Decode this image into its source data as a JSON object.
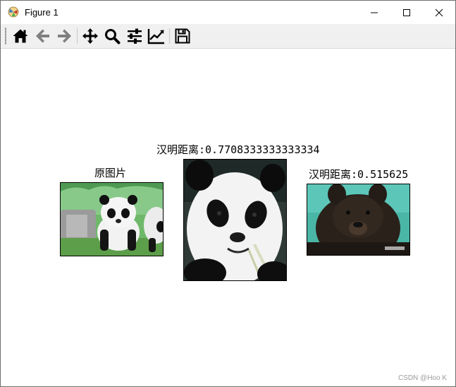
{
  "window": {
    "title": "Figure 1"
  },
  "toolbar": {
    "buttons": [
      {
        "name": "home-icon"
      },
      {
        "name": "back-arrow-icon"
      },
      {
        "name": "forward-arrow-icon"
      },
      {
        "name": "pan-move-icon"
      },
      {
        "name": "zoom-magnifier-icon"
      },
      {
        "name": "subplots-sliders-icon"
      },
      {
        "name": "edit-axis-line-icon"
      },
      {
        "name": "save-floppy-icon"
      }
    ]
  },
  "figure": {
    "panels": [
      {
        "title": "原图片",
        "image": "panda cub standing on grass"
      },
      {
        "title": "汉明距离:0.7708333333333334",
        "image": "panda face chewing bamboo"
      },
      {
        "title": "汉明距离:0.515625",
        "image": "black bear face"
      }
    ]
  },
  "watermark": "CSDN @Hoo K"
}
